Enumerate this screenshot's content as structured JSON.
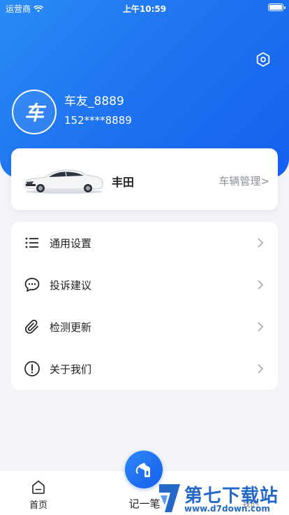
{
  "status_bar": {
    "carrier": "运营商",
    "time": "上午10:59"
  },
  "profile": {
    "avatar_text": "车",
    "username": "车友_8889",
    "phone": "152****8889"
  },
  "car": {
    "name": "丰田",
    "manage_label": "车辆管理>"
  },
  "menu": {
    "items": [
      {
        "label": "通用设置",
        "icon": "list-icon"
      },
      {
        "label": "投诉建议",
        "icon": "chat-bubble-icon"
      },
      {
        "label": "检测更新",
        "icon": "paperclip-icon"
      },
      {
        "label": "关于我们",
        "icon": "info-icon"
      }
    ]
  },
  "tabbar": {
    "home_label": "首页",
    "record_label": "记一笔",
    "mine_label": "我的"
  },
  "watermark": {
    "text": "第七下载站",
    "url": "www.d7down.com"
  },
  "colors": {
    "primary": "#1f74f0",
    "header_light": "#2a8bf5",
    "background": "#f2f4f8"
  }
}
